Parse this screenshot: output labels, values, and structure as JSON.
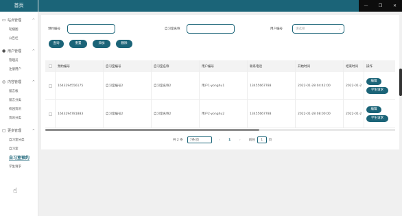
{
  "sidebar": {
    "logo": "首页",
    "groups": [
      {
        "title": "站点管理",
        "icon": "monitor-icon",
        "items": [
          "轮播图",
          "公告栏"
        ]
      },
      {
        "title": "用户管理",
        "icon": "user-icon",
        "items": [
          "管理员",
          "注册用户"
        ]
      },
      {
        "title": "内容管理",
        "icon": "content-icon",
        "items": [
          "留言板",
          "留言分类",
          "校园资讯",
          "资讯分类"
        ]
      },
      {
        "title": "更多管理",
        "icon": "folder-icon",
        "items": [
          "自习室分类",
          "自习室",
          "自习室预约",
          "学生请求"
        ]
      }
    ],
    "active_item": "自习室预约"
  },
  "window_controls": [
    "—",
    "❐",
    "✕"
  ],
  "search": {
    "field1_label": "预约编号",
    "field1_value": "",
    "field2_label": "自习室名称",
    "field2_value": "",
    "field3_label": "用户编号",
    "field3_placeholder": "请选择"
  },
  "buttons": {
    "query": "查询",
    "reset": "重置",
    "add": "添加",
    "delete": "删除"
  },
  "table": {
    "headers": [
      "预约编号",
      "自习室编号",
      "自习室名称",
      "用户编号",
      "联系电话",
      "开始时间",
      "结束时间",
      "操作"
    ],
    "rows": [
      [
        "1643294556175",
        "自习室编号2",
        "自习室名称2",
        "用户1-yonghu1",
        "13455667788",
        "2022-01-28 04:42:00",
        "2022-01-2"
      ],
      [
        "1643294781883",
        "自习室编号2",
        "自习室名称2",
        "用户2-yonghu2",
        "13455667788",
        "2022-01-28 08:00:00",
        "2022-01-2"
      ]
    ],
    "row_actions": [
      "编辑",
      "学生请求"
    ]
  },
  "pagination": {
    "total": "共 2 条",
    "page_size": "7条/页",
    "prev": "‹",
    "current": "1",
    "next": "›",
    "goto_label": "前往",
    "goto_value": "1",
    "page_suffix": "页"
  },
  "colors": {
    "accent": "#1b6478",
    "header": "#1b6478"
  }
}
